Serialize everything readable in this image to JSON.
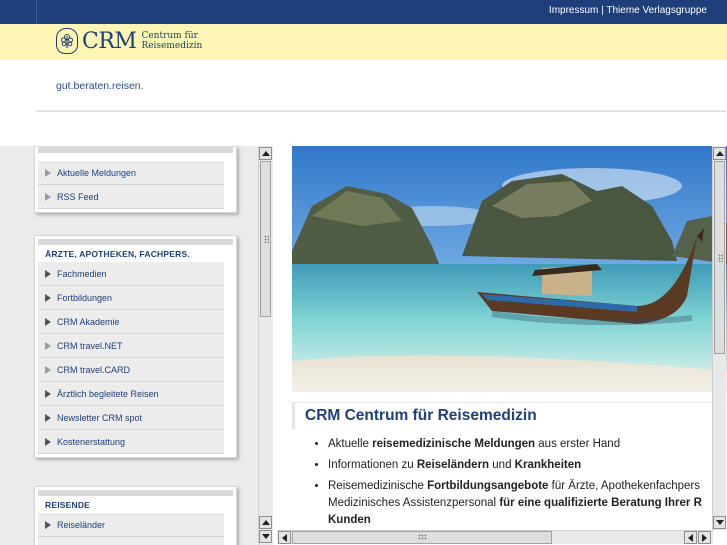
{
  "topbar": {
    "impressum": "Impressum",
    "separator": "|",
    "thieme": "Thieme Verlagsgruppe"
  },
  "logo": {
    "emblem_icon": "tree-emblem-icon",
    "crm": "CRM",
    "sub_line1": "Centrum für",
    "sub_line2": "Reisemedizin"
  },
  "slogan": "gut.beraten.reisen.",
  "sidebar": {
    "box1": {
      "items": [
        {
          "label": "Aktuelle Meldungen",
          "icon": "hollow-triangle"
        },
        {
          "label": "RSS Feed",
          "icon": "hollow-triangle"
        }
      ]
    },
    "box2": {
      "title": "ÄRZTE, APOTHEKEN, FACHPERS.",
      "items": [
        {
          "label": "Fachmedien",
          "icon": "filled-triangle"
        },
        {
          "label": "Fortbildungen",
          "icon": "filled-triangle"
        },
        {
          "label": "CRM Akademie",
          "icon": "filled-triangle"
        },
        {
          "label": "CRM travel.NET",
          "icon": "hollow-triangle"
        },
        {
          "label": "CRM travel.CARD",
          "icon": "hollow-triangle"
        },
        {
          "label": "Ärztlich begleitete Reisen",
          "icon": "filled-triangle"
        },
        {
          "label": "Newsletter CRM spot",
          "icon": "filled-triangle"
        },
        {
          "label": "Kostenerstattung",
          "icon": "filled-triangle"
        }
      ]
    },
    "box3": {
      "title": "REISENDE",
      "items": [
        {
          "label": "Reiseländer",
          "icon": "filled-triangle"
        }
      ]
    }
  },
  "main": {
    "hero_image": "tropical-beach-longtail-boat",
    "heading": "CRM Centrum für Reisemedizin",
    "bullets": [
      {
        "pre": "Aktuelle ",
        "bold": "reisemedizinische Meldungen",
        "post": " aus erster Hand"
      },
      {
        "pre": "Informationen zu ",
        "bold": "Reiseländern",
        "mid": " und ",
        "bold2": "Krankheiten"
      },
      {
        "pre": "Reisemedizinische ",
        "bold": "Fortbildungsangebote",
        "post": " für Ärzte, Apothekenfachpers"
      },
      {
        "pre": "Medizinisches Assistenzpersonal ",
        "bold": "für eine qualifizierte Beratung Ihrer R"
      },
      {
        "bold": "Kunden"
      }
    ]
  },
  "colors": {
    "brand_blue": "#1e3f79",
    "logo_band": "#fdf5b4",
    "sidebar_bg": "#ebebeb"
  }
}
